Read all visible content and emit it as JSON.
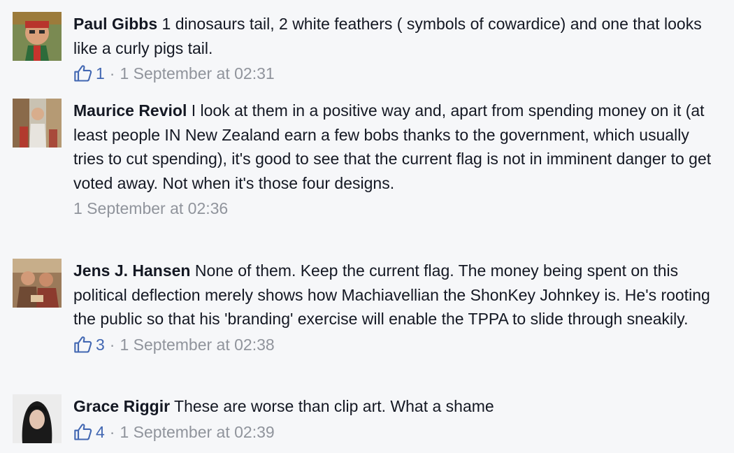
{
  "comments": [
    {
      "author": "Paul Gibbs",
      "text": "1 dinosaurs tail, 2 white feathers ( symbols of cowardice) and one that looks like a curly pigs tail.",
      "likes": "1",
      "separator": "·",
      "timestamp": "1 September at 02:31"
    },
    {
      "author": "Maurice Reviol",
      "text": "I look at them in a positive way and, apart from spending money on it (at least people IN New Zealand earn a few bobs thanks to the government, which usually tries to cut spending), it's good to see that the current flag is not in imminent danger to get voted away. Not when it's those four designs.",
      "timestamp": "1 September at 02:36"
    },
    {
      "author": "Jens J. Hansen",
      "text": "None of them. Keep the current flag. The money being spent on this political deflection merely shows how Machiavellian the ShonKey Johnkey is. He's rooting the public so that his 'branding' exercise will enable the TPPA to slide through sneakily.",
      "likes": "3",
      "separator": "·",
      "timestamp": "1 September at 02:38"
    },
    {
      "author": "Grace Riggir",
      "text": "These are worse than clip art. What a shame",
      "likes": "4",
      "separator": "·",
      "timestamp": "1 September at 02:39"
    }
  ],
  "icons": {
    "like": "thumbs-up-icon"
  },
  "colors": {
    "background": "#f6f7f9",
    "text": "#141823",
    "meta": "#90949c",
    "like_blue": "#4267b2"
  }
}
